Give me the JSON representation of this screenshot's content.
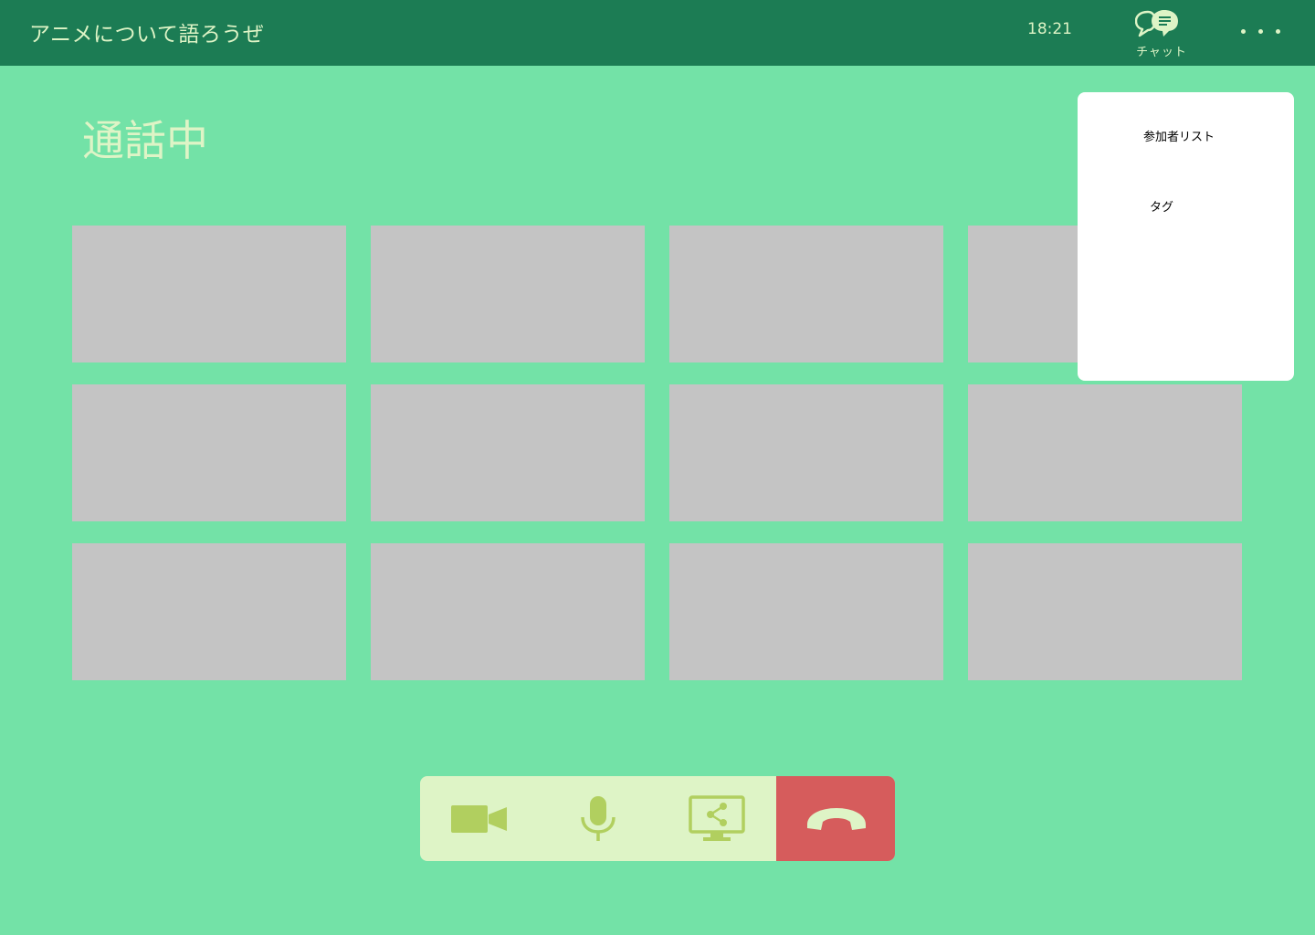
{
  "header": {
    "room_title": "アニメについて語ろうぜ",
    "time": "18:21",
    "chat_label": "チャット",
    "chat_icon": "chat-bubble-icon",
    "more_icon": "more-horizontal-icon"
  },
  "main": {
    "status_title": "通話中",
    "participant_tile_count": 12
  },
  "menu": {
    "items": [
      {
        "label": "参加者リスト"
      },
      {
        "label": "タグ"
      }
    ]
  },
  "controls": [
    {
      "name": "camera-toggle-button",
      "icon": "video-camera-icon"
    },
    {
      "name": "microphone-toggle-button",
      "icon": "microphone-icon"
    },
    {
      "name": "screen-share-button",
      "icon": "screen-share-icon"
    },
    {
      "name": "hang-up-button",
      "icon": "phone-hangup-icon"
    }
  ],
  "colors": {
    "header_bg": "#1c7c54",
    "page_bg": "#73e2a7",
    "text_light": "#def4c6",
    "tile_placeholder": "#c4c4c4",
    "control_bar_bg": "#def4c6",
    "control_icon": "#b1cf5f",
    "hangup_bg": "#d65c5c"
  }
}
